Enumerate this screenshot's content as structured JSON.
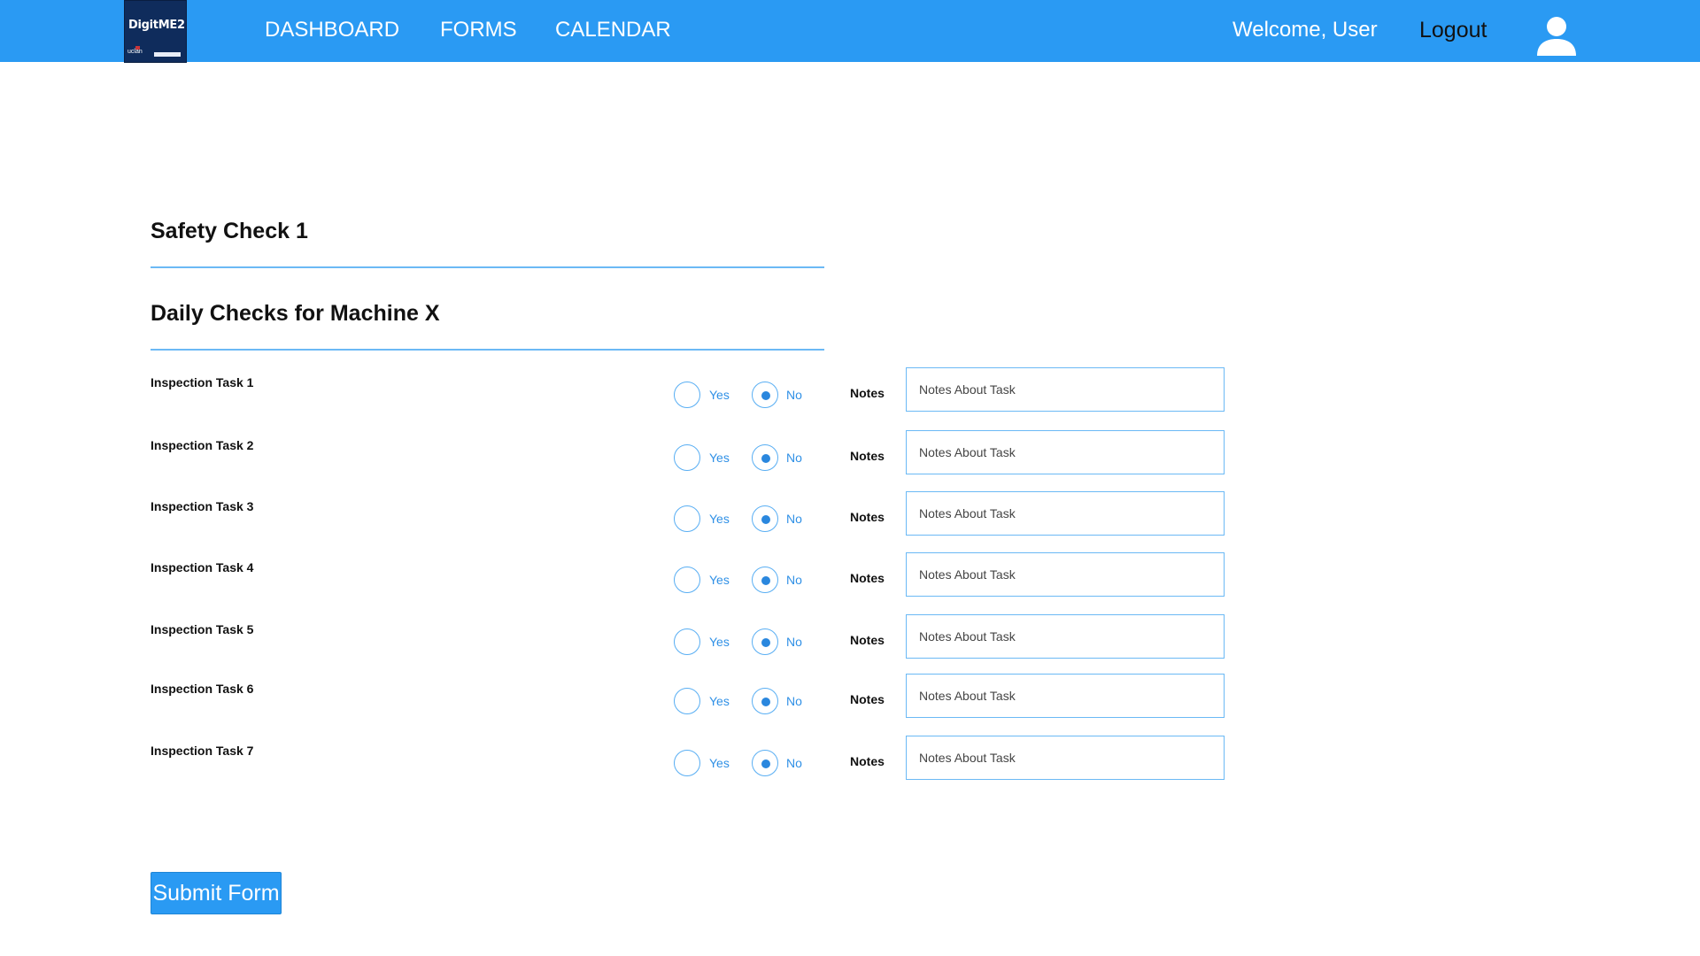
{
  "brand": {
    "logo_text": "DigitME2",
    "logo_sub": "uclan"
  },
  "nav": {
    "dashboard": "DASHBOARD",
    "forms": "FORMS",
    "calendar": "CALENDAR",
    "welcome": "Welcome, User",
    "logout": "Logout"
  },
  "form": {
    "title": "Safety Check 1",
    "subtitle": "Daily Checks for Machine X",
    "yes_label": "Yes",
    "no_label": "No",
    "notes_label": "Notes",
    "notes_placeholder": "Notes About Task",
    "submit_label": "Submit Form",
    "tasks": [
      {
        "label": "Inspection Task 1",
        "selected": "No"
      },
      {
        "label": "Inspection Task 2",
        "selected": "No"
      },
      {
        "label": "Inspection Task 3",
        "selected": "No"
      },
      {
        "label": "Inspection Task 4",
        "selected": "No"
      },
      {
        "label": "Inspection Task 5",
        "selected": "No"
      },
      {
        "label": "Inspection Task 6",
        "selected": "No"
      },
      {
        "label": "Inspection Task 7",
        "selected": "No"
      }
    ]
  },
  "colors": {
    "primary": "#2a9af3",
    "accent": "#2a87de",
    "rule": "#6bb9f5"
  }
}
